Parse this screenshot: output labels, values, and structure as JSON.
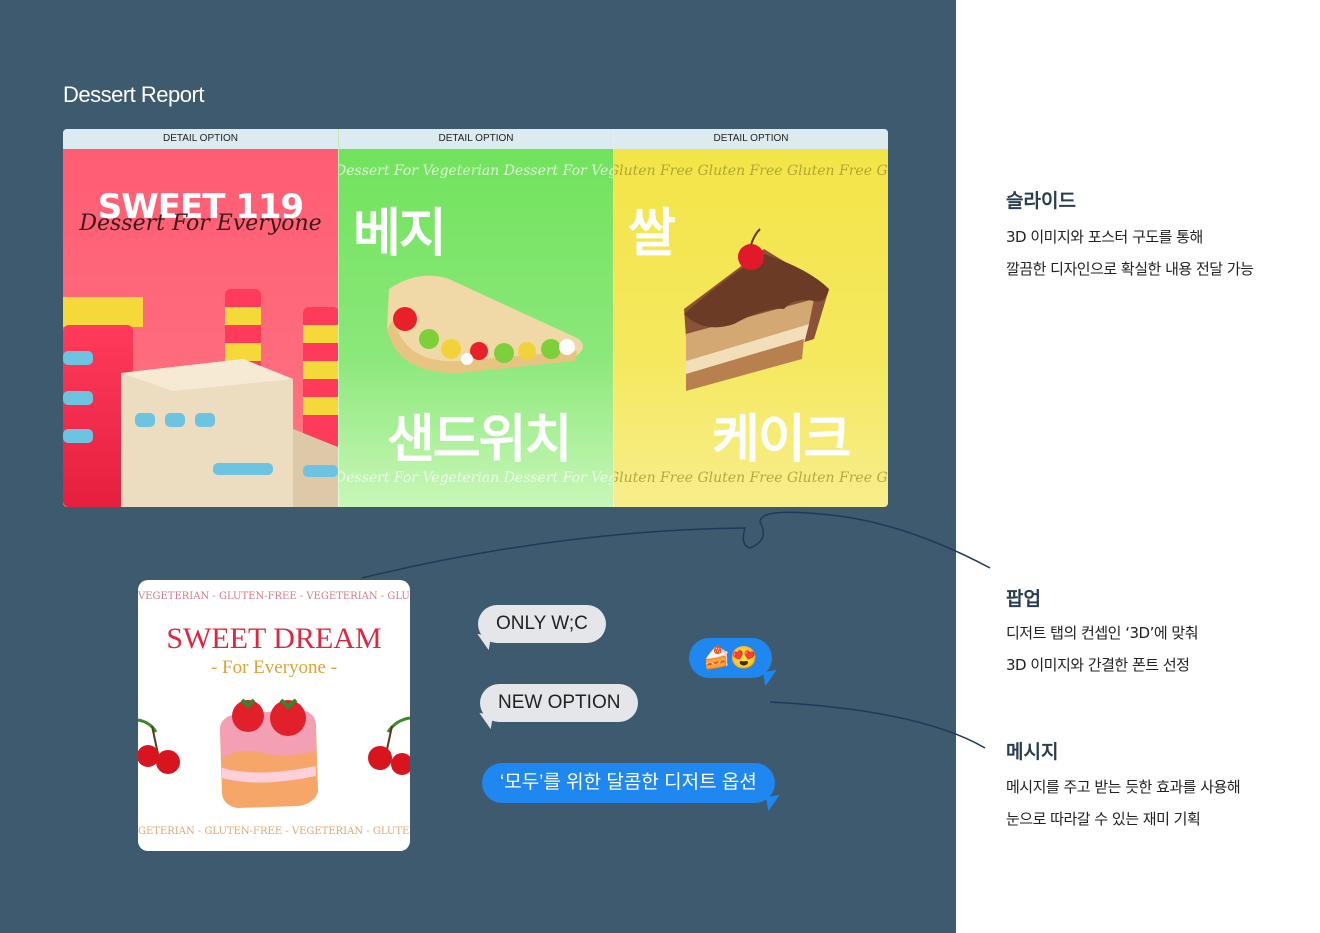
{
  "report": {
    "title": "Dessert Report"
  },
  "slides": [
    {
      "tab": "DETAIL OPTION",
      "title": "SWEET 119",
      "subtitle": "Dessert For Everyone"
    },
    {
      "tab": "DETAIL OPTION",
      "ticker": "Dessert For Vegeterian  Dessert For Vegeterian",
      "top": "베지",
      "bottom": "샌드위치"
    },
    {
      "tab": "DETAIL OPTION",
      "ticker": "Gluten Free  Gluten Free  Gluten Free  Gluten Free",
      "top": "쌀",
      "bottom": "케이크"
    }
  ],
  "popup": {
    "ticker": "VEGETERIAN - GLUTEN-FREE - VEGETERIAN - GLUTEN-FREE",
    "ticker_bottom": "GETERIAN - GLUTEN-FREE - VEGETERIAN - GLUTEN-FREE",
    "title": "SWEET DREAM",
    "subtitle": "- For Everyone -"
  },
  "messages": {
    "m1": "ONLY W;C",
    "m2": "NEW OPTION",
    "m3": "‘모두’를 위한 달콤한 디저트 옵션",
    "emoji": "🍰😍"
  },
  "sections": {
    "slide": {
      "title": "슬라이드",
      "line1": "3D 이미지와 포스터 구도를 통해",
      "line2": "깔끔한 디자인으로 확실한 내용 전달 가능"
    },
    "popup": {
      "title": "팝업",
      "line1": "디저트 탭의 컨셉인 ‘3D’에 맞춰",
      "line2": "3D 이미지와 간결한 폰트 선정"
    },
    "message": {
      "title": "메시지",
      "line1": "메시지를 주고 받는 듯한 효과를 사용해",
      "line2": "눈으로 따라갈 수 있는 재미 기획"
    }
  },
  "colors": {
    "panel": "#3d5a6e",
    "accent_blue": "#1f87f0",
    "pink": "#ff5b73",
    "green": "#6fe25a",
    "yellow": "#f3e446"
  }
}
